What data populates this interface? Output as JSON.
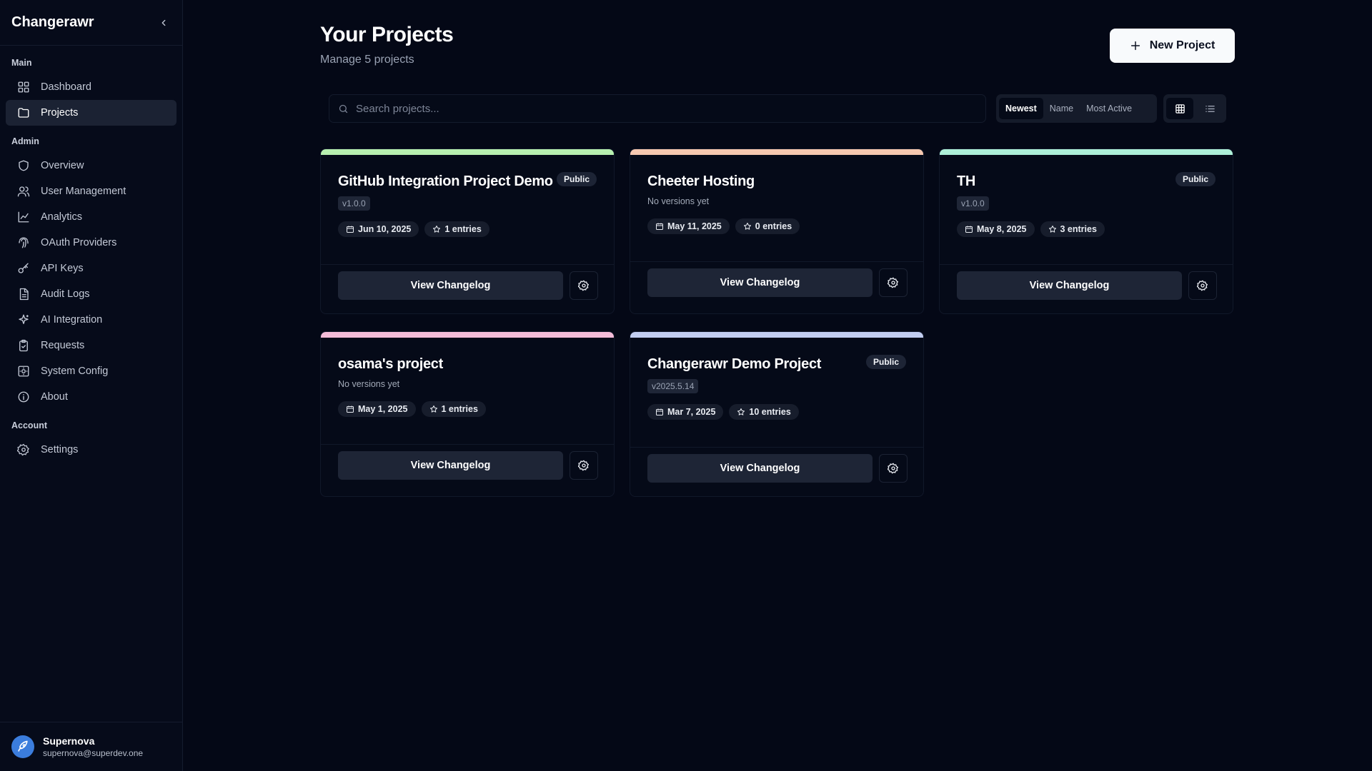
{
  "sidebar": {
    "brand": "Changerawr",
    "sections": {
      "main": {
        "label": "Main",
        "items": [
          {
            "label": "Dashboard",
            "icon": "grid-icon"
          },
          {
            "label": "Projects",
            "icon": "folder-icon",
            "active": true
          }
        ]
      },
      "admin": {
        "label": "Admin",
        "items": [
          {
            "label": "Overview",
            "icon": "shield-icon"
          },
          {
            "label": "User Management",
            "icon": "users-icon"
          },
          {
            "label": "Analytics",
            "icon": "chart-icon"
          },
          {
            "label": "OAuth Providers",
            "icon": "fingerprint-icon"
          },
          {
            "label": "API Keys",
            "icon": "key-icon"
          },
          {
            "label": "Audit Logs",
            "icon": "file-text-icon"
          },
          {
            "label": "AI Integration",
            "icon": "sparkles-icon"
          },
          {
            "label": "Requests",
            "icon": "clipboard-icon"
          },
          {
            "label": "System Config",
            "icon": "config-icon"
          },
          {
            "label": "About",
            "icon": "info-icon"
          }
        ]
      },
      "account": {
        "label": "Account",
        "items": [
          {
            "label": "Settings",
            "icon": "gear-icon"
          }
        ]
      }
    },
    "user": {
      "name": "Supernova",
      "email": "supernova@superdev.one"
    }
  },
  "header": {
    "title": "Your Projects",
    "subtitle": "Manage 5 projects",
    "new_button": "New Project"
  },
  "search": {
    "placeholder": "Search projects...",
    "value": ""
  },
  "sort": {
    "options": [
      "Newest",
      "Name",
      "Most Active"
    ],
    "selected": "Newest"
  },
  "view_mode": {
    "selected": "grid"
  },
  "projects": [
    {
      "name": "GitHub Integration Project Demo",
      "public": "Public",
      "version": "v1.0.0",
      "date": "Jun 10, 2025",
      "entries": "1 entries",
      "view_label": "View Changelog",
      "accent": "#b7f0b0"
    },
    {
      "name": "Cheeter Hosting",
      "public": "",
      "version": "",
      "no_versions": "No versions yet",
      "date": "May 11, 2025",
      "entries": "0 entries",
      "view_label": "View Changelog",
      "accent": "#f6c8b0"
    },
    {
      "name": "TH",
      "public": "Public",
      "version": "v1.0.0",
      "date": "May 8, 2025",
      "entries": "3 entries",
      "view_label": "View Changelog",
      "accent": "#aef0d8"
    },
    {
      "name": "osama's project",
      "public": "",
      "version": "",
      "no_versions": "No versions yet",
      "date": "May 1, 2025",
      "entries": "1 entries",
      "view_label": "View Changelog",
      "accent": "#f4bcd8"
    },
    {
      "name": "Changerawr Demo Project",
      "public": "Public",
      "version": "v2025.5.14",
      "date": "Mar 7, 2025",
      "entries": "10 entries",
      "view_label": "View Changelog",
      "accent": "#c2cdf0"
    }
  ]
}
